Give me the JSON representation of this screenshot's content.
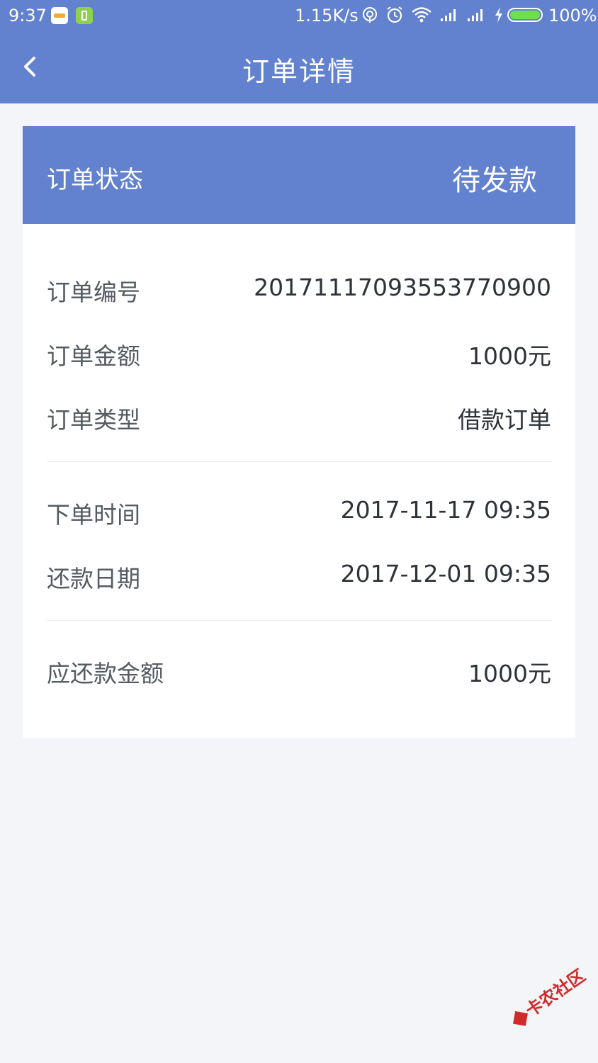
{
  "status_bar": {
    "time": "9:37",
    "net_speed": "1.15K/s",
    "battery": "100%",
    "battery_level": 1.0,
    "icons": [
      "app-icon-news",
      "app-icon-green",
      "hotspot-icon",
      "alarm-icon",
      "wifi-icon",
      "signal-icon",
      "signal-icon",
      "charging-icon",
      "battery-icon"
    ]
  },
  "nav": {
    "title": "订单详情",
    "back_icon": "chevron-left-icon"
  },
  "card": {
    "header": {
      "label": "订单状态",
      "value": "待发款"
    },
    "rows": [
      {
        "label": "订单编号",
        "value": "20171117093553770900"
      },
      {
        "label": "订单金额",
        "value": "1000元"
      },
      {
        "label": "订单类型",
        "value": "借款订单"
      },
      {
        "label": "下单时间",
        "value": "2017-11-17 09:35"
      },
      {
        "label": "还款日期",
        "value": "2017-12-01 09:35"
      },
      {
        "label": "应还款金额",
        "value": "1000元"
      }
    ]
  },
  "watermark": "卡农社区",
  "colors": {
    "primary": "#6282cf",
    "background": "#f4f5f8",
    "card": "#ffffff",
    "label_text": "#555a63",
    "value_text": "#2e323a",
    "watermark": "#d12a2a"
  }
}
